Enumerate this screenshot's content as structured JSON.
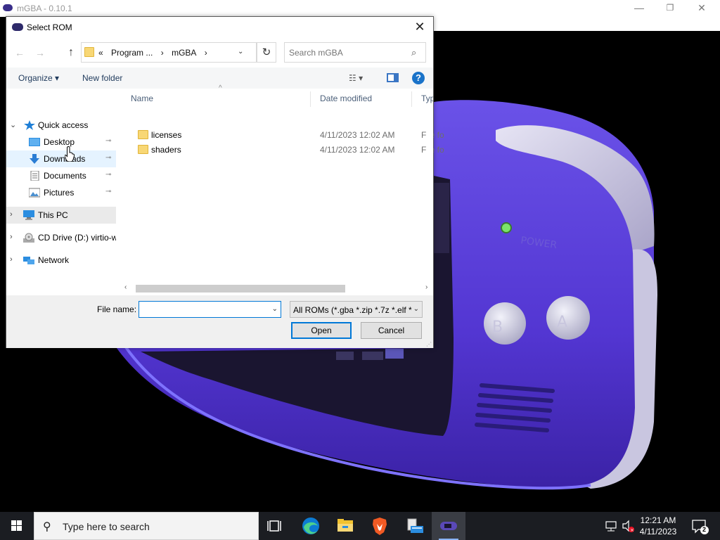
{
  "main_window": {
    "title": "mGBA - 0.10.1",
    "minimize_glyph": "—",
    "maximize_glyph": "❐",
    "close_glyph": "✕"
  },
  "dialog": {
    "title": "Select ROM",
    "close_glyph": "✕",
    "nav": {
      "back_glyph": "←",
      "forward_glyph": "→",
      "up_glyph": "↑",
      "breadcrumb_prefix": "«",
      "breadcrumbs": [
        "Program ...",
        "mGBA"
      ],
      "crumb_sep": "›",
      "dropdown_glyph": "⌄",
      "refresh_glyph": "↻"
    },
    "search": {
      "placeholder": "Search mGBA",
      "icon_glyph": "⌕"
    },
    "toolbar": {
      "organize_label": "Organize ▾",
      "new_folder_label": "New folder",
      "views_glyph": "☷ ▾",
      "help_glyph": "?"
    },
    "navpane": {
      "quick_access": "Quick access",
      "items": [
        {
          "label": "Desktop",
          "pinned": true
        },
        {
          "label": "Downloads",
          "pinned": true
        },
        {
          "label": "Documents",
          "pinned": true
        },
        {
          "label": "Pictures",
          "pinned": true
        }
      ],
      "this_pc": "This PC",
      "cd_drive": "CD Drive (D:) virtio-w",
      "network": "Network",
      "pin_glyph": "📌",
      "expand_glyph": "›",
      "collapse_glyph": "⌄"
    },
    "columns": {
      "name": "Name",
      "date": "Date modified",
      "type": "Type",
      "sort_glyph": "^"
    },
    "files": [
      {
        "name": "licenses",
        "date": "4/11/2023 12:02 AM",
        "type": "File fo"
      },
      {
        "name": "shaders",
        "date": "4/11/2023 12:02 AM",
        "type": "File fo"
      }
    ],
    "scroll": {
      "left_glyph": "‹",
      "right_glyph": "›"
    },
    "bottom": {
      "file_name_label": "File name:",
      "file_name_value": "",
      "filter_value": "All ROMs (*.gba *.zip *.7z *.elf *",
      "open_label": "Open",
      "cancel_label": "Cancel",
      "dropdown_glyph": "⌄"
    }
  },
  "taskbar": {
    "search_placeholder": "Type here to search",
    "search_glyph": "⚲",
    "time": "12:21 AM",
    "date": "4/11/2023",
    "notification_count": "2"
  },
  "colors": {
    "accent": "#0078d7",
    "folder": "#f8d775",
    "gba_purple": "#5b45d6"
  }
}
